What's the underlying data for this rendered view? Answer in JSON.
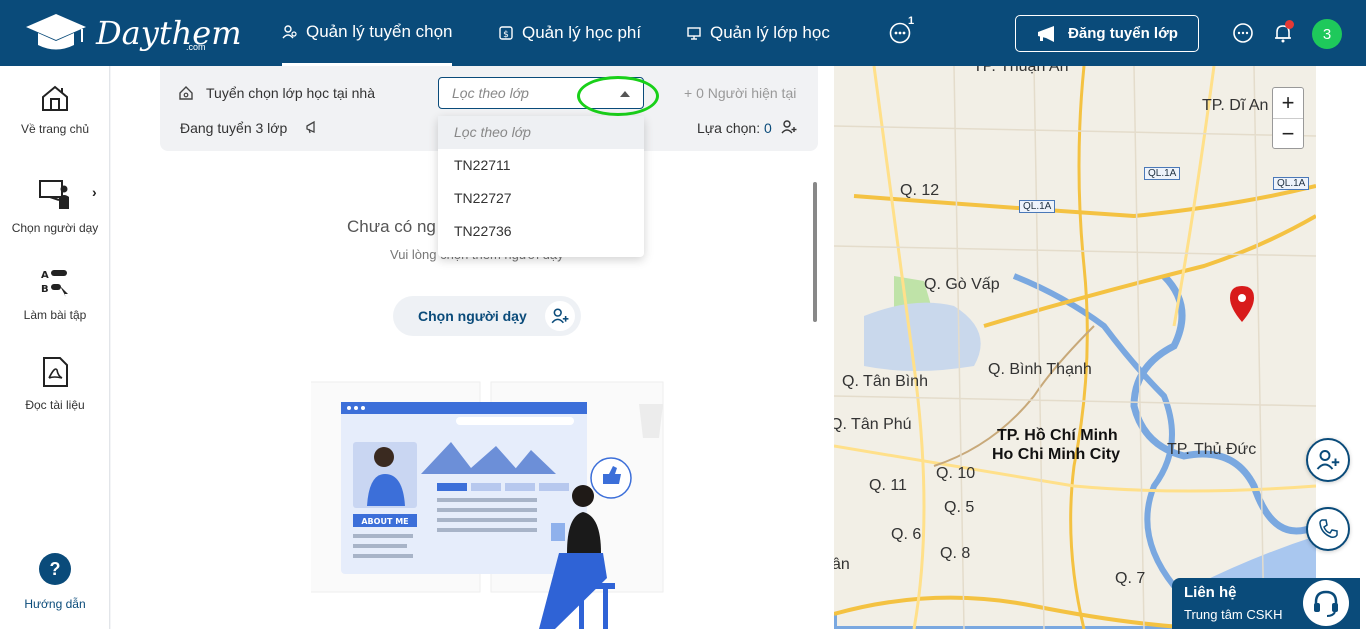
{
  "brand": {
    "name": "Daythem",
    "suffix": ".com"
  },
  "nav": {
    "items": [
      {
        "label": "Quản lý tuyển chọn",
        "icon": "people-search-icon",
        "active": true
      },
      {
        "label": "Quản lý học phí",
        "icon": "money-icon",
        "active": false
      },
      {
        "label": "Quản lý lớp học",
        "icon": "classroom-icon",
        "active": false
      }
    ],
    "more_badge": "1",
    "post_button": "Đăng tuyển lớp",
    "avatar_initial": "3"
  },
  "sidebar": {
    "items": [
      {
        "label": "Về trang chủ",
        "icon": "home-icon"
      },
      {
        "label": "Chọn người dạy",
        "icon": "teacher-board-icon"
      },
      {
        "label": "Làm bài tập",
        "icon": "quiz-icon"
      },
      {
        "label": "Đọc tài liệu",
        "icon": "pdf-icon"
      }
    ],
    "help_label": "Hướng dẫn"
  },
  "filter": {
    "title": "Tuyển chọn lớp học tại nhà",
    "select_placeholder": "Lọc theo lớp",
    "current": "+ 0 Người hiện tại",
    "status": "Đang tuyển 3 lớp",
    "choice_label": "Lựa chọn:",
    "choice_count": "0",
    "options": [
      "Lọc theo lớp",
      "TN22711",
      "TN22727",
      "TN22736"
    ]
  },
  "empty": {
    "title": "Chưa có ng",
    "subtitle": "Vui lòng chọn thêm người dạy",
    "button": "Chọn người dạy",
    "illustration_badge": "ABOUT ME"
  },
  "map": {
    "labels": [
      "TP. Thuận An",
      "TP. Dĩ An",
      "Q. 12",
      "Q. Gò Vấp",
      "Q. Bình Thạnh",
      "Q. Tân Bình",
      "Q. Tân Phú",
      "TP. Hồ Chí Minh",
      "Ho Chi Minh City",
      "TP. Thủ Đức",
      "Q. 10",
      "Q. 11",
      "Q. 5",
      "Q. 6",
      "Q. 8",
      "Q. 7",
      "ân"
    ],
    "road_tags": [
      "QL.1A",
      "QL.1A",
      "QL.1A"
    ],
    "zoom_in": "+",
    "zoom_out": "−"
  },
  "contact": {
    "title": "Liên hệ",
    "subtitle": "Trung tâm CSKH"
  },
  "colors": {
    "primary": "#0a4b7a",
    "accent_green": "#1ec95b",
    "highlight_ring": "#19d019",
    "notif": "#e53935"
  }
}
